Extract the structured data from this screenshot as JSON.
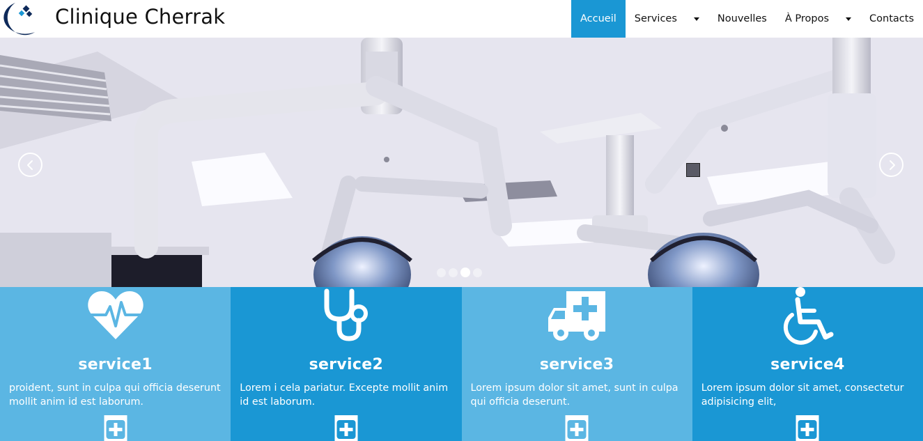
{
  "brand": {
    "name": "Clinique Cherrak",
    "logo_icon": "clinic-logo-icon"
  },
  "nav": {
    "items": [
      {
        "label": "Accueil",
        "active": true
      },
      {
        "label": "Services",
        "has_dropdown": true
      },
      {
        "label": "Nouvelles"
      },
      {
        "label": "À Propos",
        "has_dropdown": true
      },
      {
        "label": "Contacts"
      }
    ],
    "active_color": "#1a97d4"
  },
  "slider": {
    "image": "operating-room-lights-photo",
    "prev_icon": "chevron-left-icon",
    "next_icon": "chevron-right-icon",
    "slide_count": 4,
    "active_slide": 3
  },
  "services": [
    {
      "icon": "heartbeat-icon",
      "title": "service1",
      "text": "proident, sunt in culpa qui officia deserunt mollit anim id est laborum.",
      "button_icon": "plus-square-icon"
    },
    {
      "icon": "stethoscope-icon",
      "title": "service2",
      "text": "Lorem i cela pariatur. Excepte mollit anim id est laborum.",
      "button_icon": "plus-square-icon"
    },
    {
      "icon": "ambulance-icon",
      "title": "service3",
      "text": "Lorem ipsum dolor sit amet, sunt in culpa qui officia deserunt.",
      "button_icon": "plus-square-icon"
    },
    {
      "icon": "wheelchair-icon",
      "title": "service4",
      "text": "Lorem ipsum dolor sit amet, consectetur adipisicing elit,",
      "button_icon": "plus-square-icon"
    }
  ],
  "colors": {
    "light_blue": "#5bb6e3",
    "dark_blue": "#1a97d4"
  }
}
